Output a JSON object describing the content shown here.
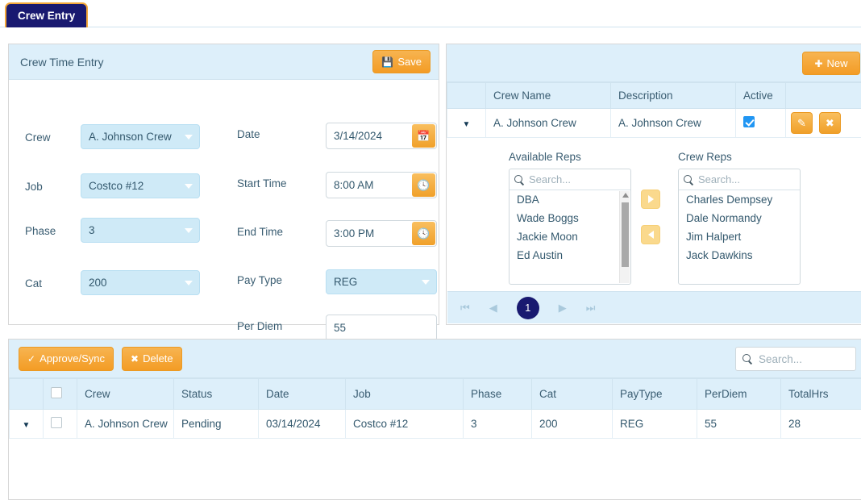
{
  "tab": {
    "label": "Crew Entry"
  },
  "crew_time_entry": {
    "title": "Crew Time Entry",
    "save_label": "Save",
    "save_icon": "floppy-disk-icon",
    "fields": {
      "crew_label": "Crew",
      "crew_value": "A. Johnson Crew",
      "job_label": "Job",
      "job_value": "Costco #12",
      "phase_label": "Phase",
      "phase_value": "3",
      "cat_label": "Cat",
      "cat_value": "200",
      "date_label": "Date",
      "date_value": "3/14/2024",
      "start_time_label": "Start Time",
      "start_time_value": "8:00 AM",
      "end_time_label": "End Time",
      "end_time_value": "3:00 PM",
      "pay_type_label": "Pay Type",
      "pay_type_value": "REG",
      "per_diem_label": "Per Diem",
      "per_diem_value": "55"
    }
  },
  "crew_grid": {
    "new_label": "New",
    "columns": [
      "Crew Name",
      "Description",
      "Active"
    ],
    "row": {
      "crew_name": "A. Johnson Crew",
      "description": "A. Johnson Crew",
      "active": true,
      "edit_icon": "pencil-icon",
      "delete_icon": "close-x-icon"
    },
    "detail": {
      "available_label": "Available Reps",
      "crew_reps_label": "Crew Reps",
      "search_placeholder": "Search...",
      "available_reps": [
        "DBA",
        "Wade Boggs",
        "Jackie Moon",
        "Ed Austin"
      ],
      "crew_reps": [
        "Charles Dempsey",
        "Dale Normandy",
        "Jim Halpert",
        "Jack Dawkins"
      ]
    },
    "pager": {
      "first": "first-page-icon",
      "prev": "prev-page-icon",
      "current": "1",
      "next": "next-page-icon",
      "last": "last-page-icon"
    }
  },
  "entries": {
    "approve_label": "Approve/Sync",
    "delete_label": "Delete",
    "search_placeholder": "Search...",
    "columns": [
      "Crew",
      "Status",
      "Date",
      "Job",
      "Phase",
      "Cat",
      "PayType",
      "PerDiem",
      "TotalHrs"
    ],
    "rows": [
      {
        "crew": "A. Johnson Crew",
        "status": "Pending",
        "date": "03/14/2024",
        "job": "Costco #12",
        "phase": "3",
        "cat": "200",
        "paytype": "REG",
        "perdiem": "55",
        "totalhrs": "28"
      }
    ]
  },
  "colors": {
    "accent_orange": "#f4a83a",
    "tab_navy": "#191970",
    "panel_header_blue": "#ddeffa",
    "dropdown_blue": "#cfeaf7",
    "checkbox_blue": "#2196f3"
  }
}
